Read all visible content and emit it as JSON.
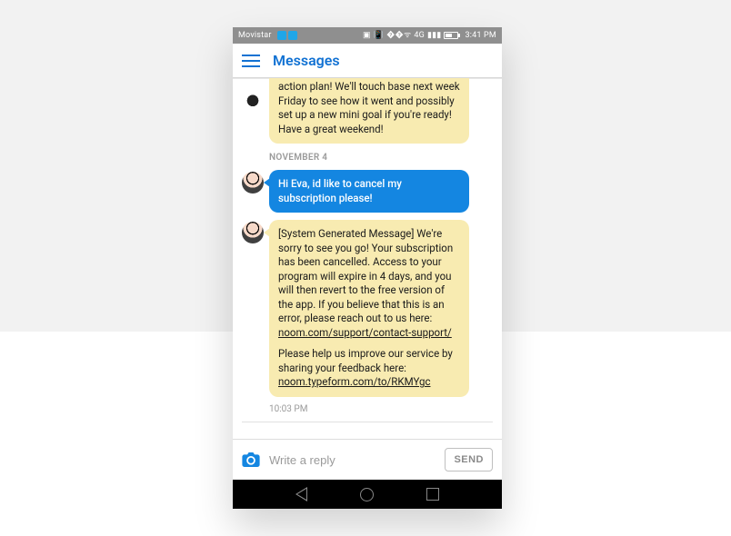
{
  "statusbar": {
    "carrier": "Movistar",
    "time": "3:41 PM",
    "network_label": "4G"
  },
  "header": {
    "title": "Messages"
  },
  "thread": {
    "partial_top_message": "action plan! We'll touch base next week Friday to see how it went and possibly set up a new mini goal if you're ready! Have a great weekend!",
    "date_separator": "NOVEMBER 4",
    "user_message": "Hi Eva, id like to cancel my subscription please!",
    "system_message_part1": "[System Generated Message] We're sorry to see you go! Your subscription has been cancelled. Access to your program will expire in 4 days, and you will then revert to the free version of the app. If you believe that this is an error, please reach out to us here: ",
    "system_link1": "noom.com/support/contact-support/",
    "system_message_part2": "Please help us improve our service by sharing your feedback here: ",
    "system_link2": "noom.typeform.com/to/RKMYgc",
    "timestamp": "10:03 PM"
  },
  "composer": {
    "placeholder": "Write a reply",
    "send_label": "SEND"
  }
}
